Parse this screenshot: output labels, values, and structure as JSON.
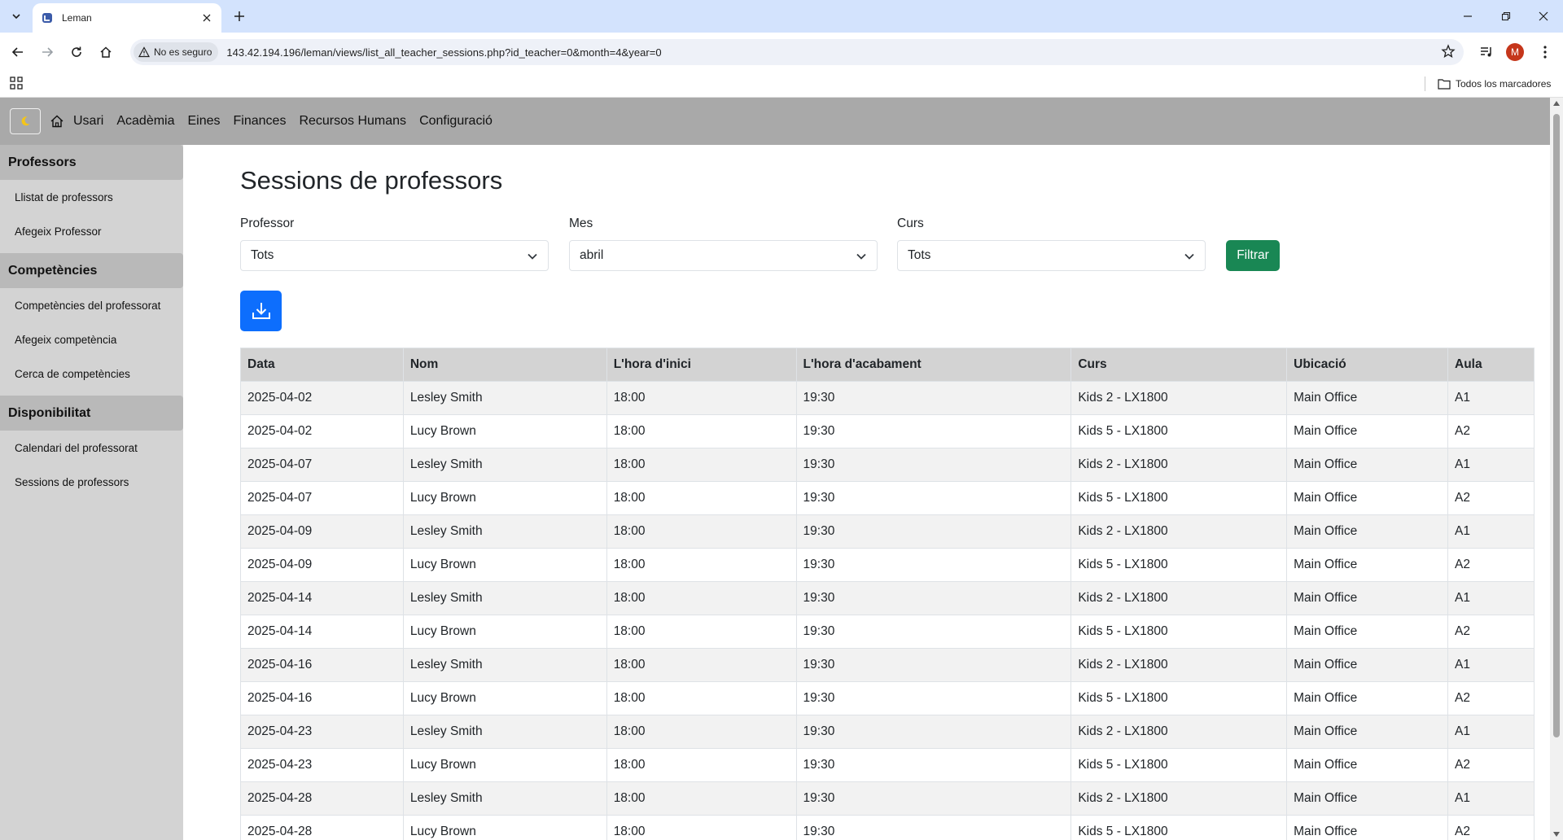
{
  "browser": {
    "tab_title": "Leman",
    "security_label": "No es seguro",
    "url": "143.42.194.196/leman/views/list_all_teacher_sessions.php?id_teacher=0&month=4&year=0",
    "avatar_letter": "M",
    "bookmarks_all": "Todos los marcadores"
  },
  "navbar": {
    "links": [
      "Usari",
      "Acadèmia",
      "Eines",
      "Finances",
      "Recursos Humans",
      "Configuració"
    ]
  },
  "sidebar": {
    "sections": [
      {
        "title": "Professors",
        "items": [
          "Llistat de professors",
          "Afegeix Professor"
        ]
      },
      {
        "title": "Competències",
        "items": [
          "Competències del professorat",
          "Afegeix competència",
          "Cerca de competències"
        ]
      },
      {
        "title": "Disponibilitat",
        "items": [
          "Calendari del professorat",
          "Sessions de professors"
        ]
      }
    ]
  },
  "main": {
    "title": "Sessions de professors",
    "filters": {
      "professor_label": "Professor",
      "professor_value": "Tots",
      "month_label": "Mes",
      "month_value": "abril",
      "course_label": "Curs",
      "course_value": "Tots",
      "filter_button": "Filtrar"
    },
    "table": {
      "headers": [
        "Data",
        "Nom",
        "L'hora d'inici",
        "L'hora d'acabament",
        "Curs",
        "Ubicació",
        "Aula"
      ],
      "rows": [
        [
          "2025-04-02",
          "Lesley Smith",
          "18:00",
          "19:30",
          "Kids 2 - LX1800",
          "Main Office",
          "A1"
        ],
        [
          "2025-04-02",
          "Lucy Brown",
          "18:00",
          "19:30",
          "Kids 5 - LX1800",
          "Main Office",
          "A2"
        ],
        [
          "2025-04-07",
          "Lesley Smith",
          "18:00",
          "19:30",
          "Kids 2 - LX1800",
          "Main Office",
          "A1"
        ],
        [
          "2025-04-07",
          "Lucy Brown",
          "18:00",
          "19:30",
          "Kids 5 - LX1800",
          "Main Office",
          "A2"
        ],
        [
          "2025-04-09",
          "Lesley Smith",
          "18:00",
          "19:30",
          "Kids 2 - LX1800",
          "Main Office",
          "A1"
        ],
        [
          "2025-04-09",
          "Lucy Brown",
          "18:00",
          "19:30",
          "Kids 5 - LX1800",
          "Main Office",
          "A2"
        ],
        [
          "2025-04-14",
          "Lesley Smith",
          "18:00",
          "19:30",
          "Kids 2 - LX1800",
          "Main Office",
          "A1"
        ],
        [
          "2025-04-14",
          "Lucy Brown",
          "18:00",
          "19:30",
          "Kids 5 - LX1800",
          "Main Office",
          "A2"
        ],
        [
          "2025-04-16",
          "Lesley Smith",
          "18:00",
          "19:30",
          "Kids 2 - LX1800",
          "Main Office",
          "A1"
        ],
        [
          "2025-04-16",
          "Lucy Brown",
          "18:00",
          "19:30",
          "Kids 5 - LX1800",
          "Main Office",
          "A2"
        ],
        [
          "2025-04-23",
          "Lesley Smith",
          "18:00",
          "19:30",
          "Kids 2 - LX1800",
          "Main Office",
          "A1"
        ],
        [
          "2025-04-23",
          "Lucy Brown",
          "18:00",
          "19:30",
          "Kids 5 - LX1800",
          "Main Office",
          "A2"
        ],
        [
          "2025-04-28",
          "Lesley Smith",
          "18:00",
          "19:30",
          "Kids 2 - LX1800",
          "Main Office",
          "A1"
        ],
        [
          "2025-04-28",
          "Lucy Brown",
          "18:00",
          "19:30",
          "Kids 5 - LX1800",
          "Main Office",
          "A2"
        ]
      ]
    }
  },
  "colors": {
    "navbar_bg": "#a9a9a9",
    "sidebar_bg": "#d3d3d3",
    "filter_button": "#198754",
    "download_button": "#0d6efd"
  },
  "icons": {
    "theme": "moon-icon",
    "home": "home-icon",
    "download": "download-icon"
  }
}
